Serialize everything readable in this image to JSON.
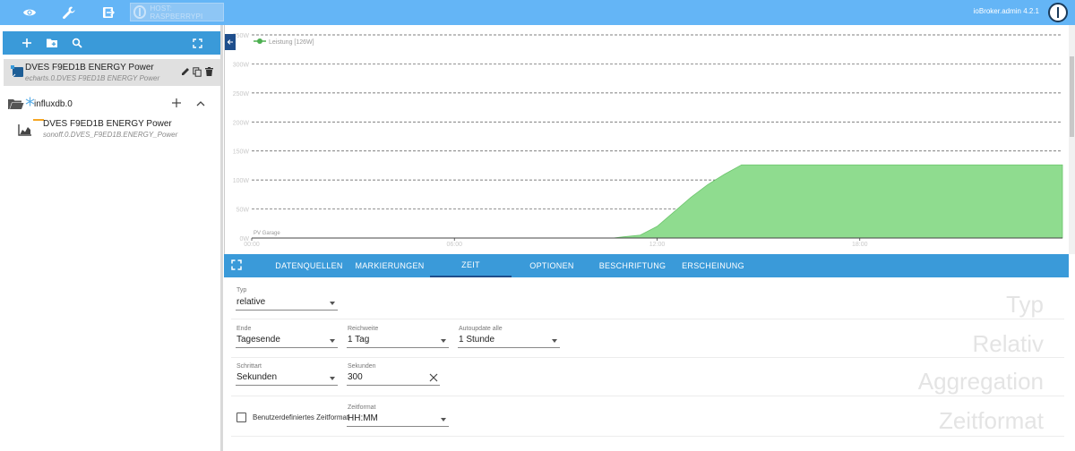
{
  "topbar": {
    "host_label": "HOST: RASPBERRYPI",
    "version": "ioBroker.admin 4.2.1",
    "icons": [
      "eye-icon",
      "wrench-icon",
      "logout-icon",
      "iobroker-logo-icon"
    ]
  },
  "left": {
    "toolbar_icons": [
      "add-icon",
      "new-folder-icon",
      "search-icon",
      "expand-icon"
    ],
    "items": [
      {
        "title": "DVES F9ED1B ENERGY Power",
        "subtitle": "echarts.0.DVES F9ED1B ENERGY Power",
        "selected": true
      },
      {
        "title": "influxdb.0",
        "subtitle": ""
      },
      {
        "title": "DVES F9ED1B ENERGY Power",
        "subtitle": "sonoff.0.DVES_F9ED1B.ENERGY_Power"
      }
    ]
  },
  "chart_data": {
    "type": "area",
    "title": "",
    "legend": [
      "Leistung [126W]"
    ],
    "legend_position": "top-left",
    "series_label": "PV Garage",
    "ylabel": "",
    "ylim": [
      0,
      350
    ],
    "yticks": [
      "0W",
      "50W",
      "100W",
      "150W",
      "200W",
      "250W",
      "300W",
      "350W"
    ],
    "xticks": [
      "00:00",
      "06:00",
      "12:00",
      "18:00"
    ],
    "x_hours": [
      0,
      10.7,
      11.0,
      11.5,
      12.0,
      12.5,
      13.0,
      13.5,
      14.0,
      14.5,
      15.0,
      15.5,
      16.0,
      16.5,
      17.0,
      24.0
    ],
    "values": [
      0,
      0,
      2,
      5,
      20,
      45,
      70,
      92,
      110,
      126,
      126,
      126,
      126,
      126,
      126,
      126
    ],
    "grid": true,
    "color": "#8fdc8f"
  },
  "tabs": {
    "items": [
      "DATENQUELLEN",
      "MARKIERUNGEN",
      "ZEIT",
      "OPTIONEN",
      "BESCHRIFTUNG",
      "ERSCHEINUNG"
    ],
    "active": "ZEIT"
  },
  "form": {
    "typ_label": "Typ",
    "typ_value": "relative",
    "ende_label": "Ende",
    "ende_value": "Tagesende",
    "reichweite_label": "Reichweite",
    "reichweite_value": "1 Tag",
    "autoupdate_label": "Autoupdate alle",
    "autoupdate_value": "1 Stunde",
    "schrittart_label": "Schrittart",
    "schrittart_value": "Sekunden",
    "sekunden_label": "Sekunden",
    "sekunden_value": "300",
    "custom_time_label": "Benutzerdefiniertes Zeitformat",
    "zeitformat_label": "Zeitformat",
    "zeitformat_value": "HH:MM",
    "ghost_typ": "Typ",
    "ghost_relativ": "Relativ",
    "ghost_aggregation": "Aggregation",
    "ghost_zeitformat": "Zeitformat"
  }
}
